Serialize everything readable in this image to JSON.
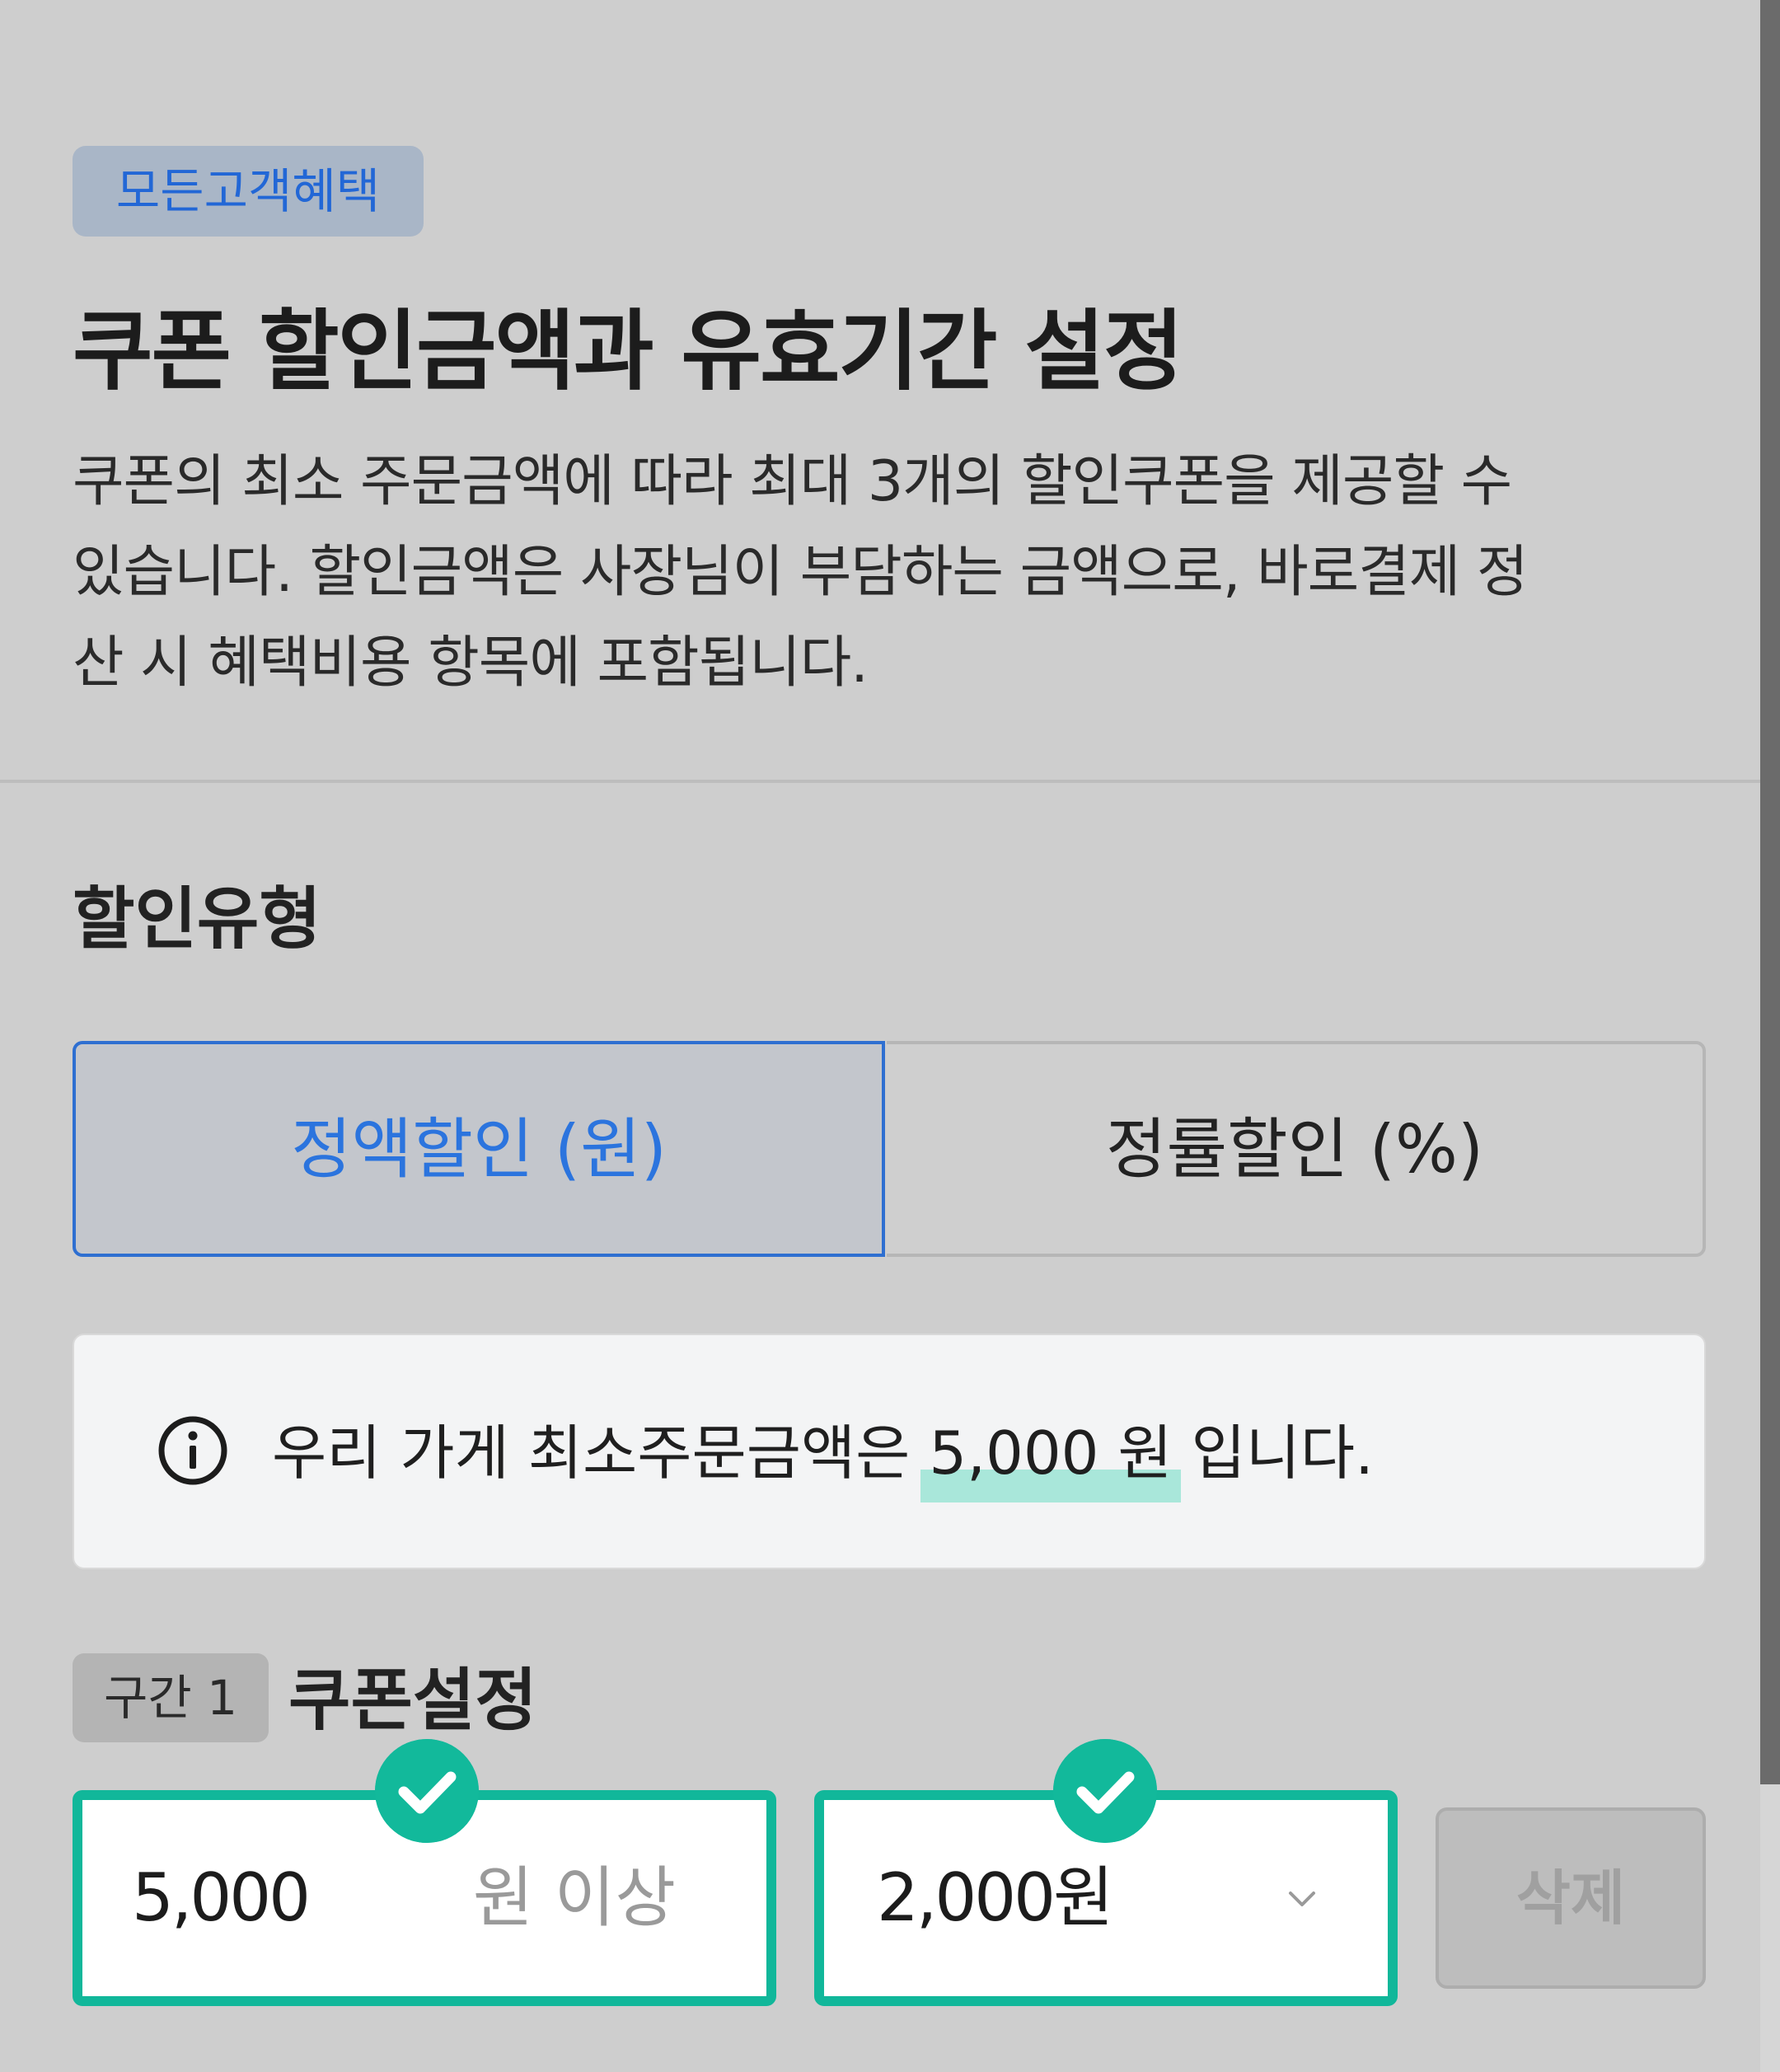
{
  "header": {
    "badge": "모든고객혜택",
    "title": "쿠폰 할인금액과 유효기간 설정",
    "description_lines": [
      "쿠폰의 최소 주문금액에 따라 최대 3개의 할인쿠폰을 제공할 수",
      "있습니다. 할인금액은 사장님이 부담하는 금액으로, 바로결제 정",
      "산 시 혜택비용 항목에 포함됩니다."
    ]
  },
  "discount_type": {
    "label": "할인유형",
    "options": [
      {
        "label": "정액할인 (원)",
        "selected": true
      },
      {
        "label": "정률할인 (%)",
        "selected": false
      }
    ]
  },
  "info": {
    "icon": "info-icon",
    "text_before": "우리 가게 최소주문금액은 ",
    "highlight": "5,000 원",
    "text_after": " 입니다."
  },
  "tier": {
    "chip": "구간 1",
    "title": "쿠폰설정",
    "min_order_value": "5,000",
    "min_order_suffix": "원 이상",
    "discount_value": "2,000원",
    "delete_label": "삭제"
  },
  "colors": {
    "accent_blue": "#2b74de",
    "valid_green": "#11b79a",
    "background": "#cecece"
  }
}
